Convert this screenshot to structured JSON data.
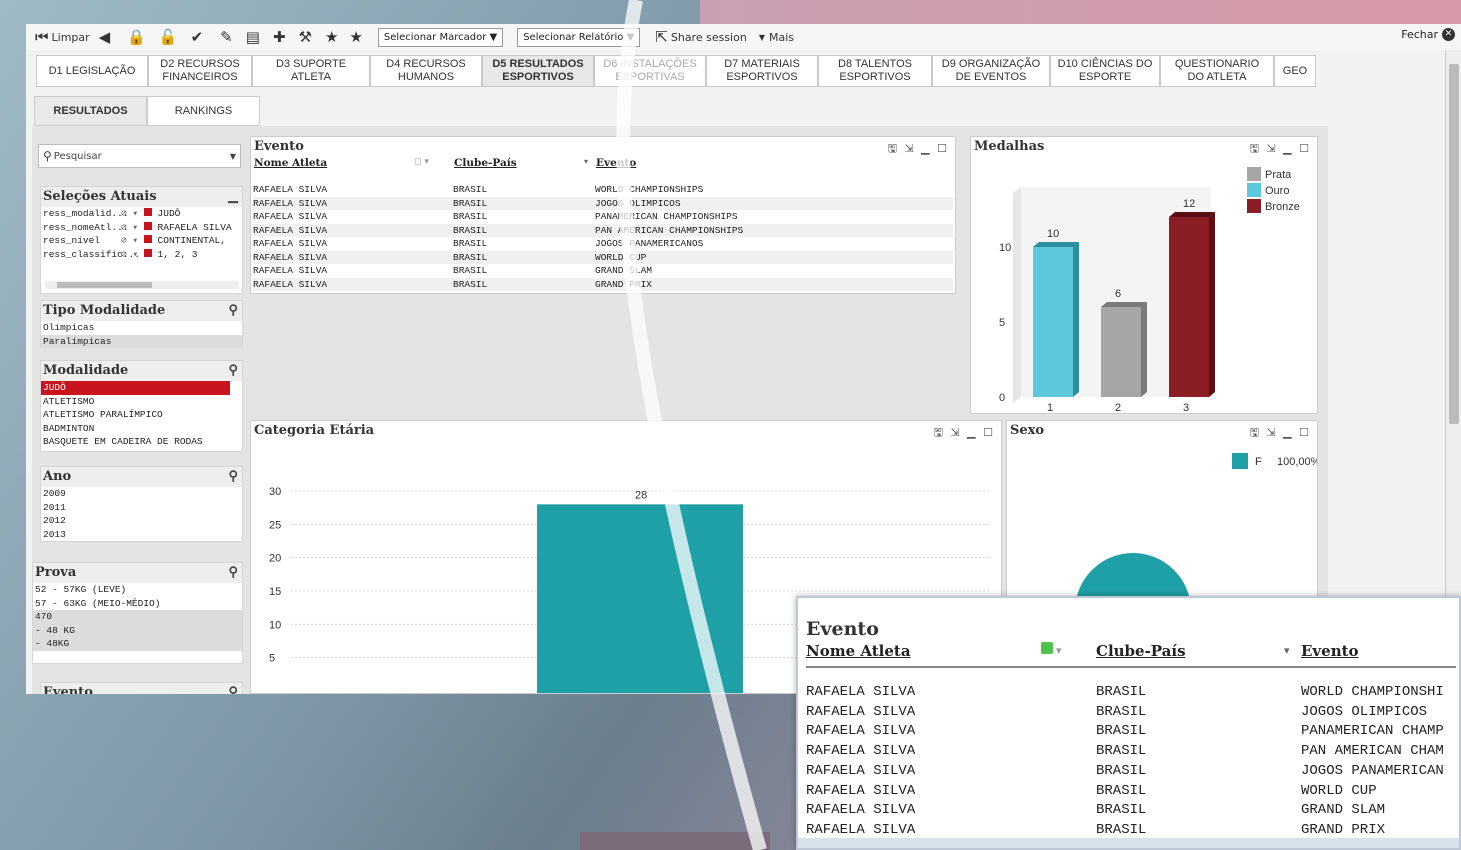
{
  "toolbar": {
    "clear_label": "Limpar",
    "bookmark_select": "Selecionar Marcador",
    "report_select": "Selecionar Relatório",
    "share_label": "Share session",
    "more_label": "Mais",
    "close_label": "Fechar"
  },
  "tabs": [
    {
      "label": "D1 LEGISLAÇÃO"
    },
    {
      "label": "D2 RECURSOS FINANCEIROS"
    },
    {
      "label": "D3 SUPORTE ATLETA"
    },
    {
      "label": "D4 RECURSOS HUMANOS"
    },
    {
      "label": "D5 RESULTADOS ESPORTIVOS"
    },
    {
      "label": "D6 INSTALAÇÕES ESPORTIVAS"
    },
    {
      "label": "D7 MATERIAIS ESPORTIVOS"
    },
    {
      "label": "D8 TALENTOS ESPORTIVOS"
    },
    {
      "label": "D9 ORGANIZAÇÃO DE EVENTOS"
    },
    {
      "label": "D10 CIÊNCIAS DO ESPORTE"
    },
    {
      "label": "QUESTIONARIO DO ATLETA"
    },
    {
      "label": "GEO"
    }
  ],
  "subtabs": [
    {
      "label": "RESULTADOS"
    },
    {
      "label": "RANKINGS"
    }
  ],
  "search": {
    "placeholder": "Pesquisar"
  },
  "current_selections": {
    "title": "Seleções Atuais",
    "rows": [
      {
        "field": "ress_modalid...",
        "value": "JUDÔ"
      },
      {
        "field": "ress_nomeAtl...",
        "value": "RAFAELA SILVA"
      },
      {
        "field": "ress_nivel",
        "value": "CONTINENTAL,"
      },
      {
        "field": "ress_classific...",
        "value": "1, 2, 3"
      }
    ]
  },
  "tipo_modalidade": {
    "title": "Tipo Modalidade",
    "items": [
      "Olímpicas",
      "Paralímpicas"
    ]
  },
  "modalidade": {
    "title": "Modalidade",
    "items": [
      "JUDÔ",
      "ATLETISMO",
      "ATLETISMO PARALÍMPICO",
      "BADMINTON",
      "BASQUETE EM CADEIRA DE RODAS"
    ]
  },
  "ano": {
    "title": "Ano",
    "items": [
      "2009",
      "2011",
      "2012",
      "2013"
    ]
  },
  "prova": {
    "title": "Prova",
    "items": [
      "52 - 57KG (LEVE)",
      "57 - 63KG (MEIO-MÉDIO)",
      "470",
      "- 48 KG",
      "- 48KG"
    ]
  },
  "evento_list": {
    "title": "Evento"
  },
  "evento_table": {
    "title": "Evento",
    "headers": [
      "Nome Atleta",
      "Clube-País",
      "Evento"
    ],
    "rows": [
      [
        "RAFAELA SILVA",
        "BRASIL",
        "WORLD CHAMPIONSHIPS"
      ],
      [
        "RAFAELA SILVA",
        "BRASIL",
        "JOGOS OLIMPICOS"
      ],
      [
        "RAFAELA SILVA",
        "BRASIL",
        "PANAMERICAN CHAMPIONSHIPS"
      ],
      [
        "RAFAELA SILVA",
        "BRASIL",
        "PAN AMERICAN CHAMPIONSHIPS"
      ],
      [
        "RAFAELA SILVA",
        "BRASIL",
        "JOGOS PANAMERICANOS"
      ],
      [
        "RAFAELA SILVA",
        "BRASIL",
        "WORLD CUP"
      ],
      [
        "RAFAELA SILVA",
        "BRASIL",
        "GRAND SLAM"
      ],
      [
        "RAFAELA SILVA",
        "BRASIL",
        "GRAND PRIX"
      ]
    ]
  },
  "zoom_table": {
    "title": "Evento",
    "headers": [
      "Nome Atleta",
      "Clube-País",
      "Evento"
    ],
    "rows": [
      [
        "RAFAELA SILVA",
        "BRASIL",
        "WORLD CHAMPIONSHI"
      ],
      [
        "RAFAELA SILVA",
        "BRASIL",
        "JOGOS OLIMPICOS"
      ],
      [
        "RAFAELA SILVA",
        "BRASIL",
        "PANAMERICAN CHAMP"
      ],
      [
        "RAFAELA SILVA",
        "BRASIL",
        "PAN AMERICAN CHAM"
      ],
      [
        "RAFAELA SILVA",
        "BRASIL",
        "JOGOS PANAMERICAN"
      ],
      [
        "RAFAELA SILVA",
        "BRASIL",
        "WORLD CUP"
      ],
      [
        "RAFAELA SILVA",
        "BRASIL",
        "GRAND SLAM"
      ],
      [
        "RAFAELA SILVA",
        "BRASIL",
        "GRAND PRIX"
      ]
    ]
  },
  "colors": {
    "prata": "#a6a6a6",
    "ouro": "#5bc8dc",
    "bronze": "#8b1d24",
    "teal": "#1f9fa6",
    "selected": "#c8141d"
  },
  "chart_data": [
    {
      "type": "bar",
      "title": "Medalhas",
      "categories": [
        "1",
        "2",
        "3"
      ],
      "series": [
        {
          "name": "Prata"
        },
        {
          "name": "Ouro"
        },
        {
          "name": "Bronze"
        }
      ],
      "values": [
        10,
        6,
        12
      ],
      "bar_series": [
        "Ouro",
        "Prata",
        "Bronze"
      ],
      "yticks": [
        0,
        5,
        10
      ],
      "ylim": [
        0,
        14
      ],
      "legend": "top-right"
    },
    {
      "type": "bar",
      "title": "Categoria Etária",
      "categories": [
        ""
      ],
      "values": [
        28
      ],
      "yticks": [
        5,
        10,
        15,
        20,
        25,
        30
      ],
      "ylim": [
        0,
        30
      ]
    },
    {
      "type": "pie",
      "title": "Sexo",
      "labels": [
        "F"
      ],
      "values": [
        100
      ],
      "display": [
        "100,00%"
      ],
      "legend": "top-right"
    }
  ]
}
